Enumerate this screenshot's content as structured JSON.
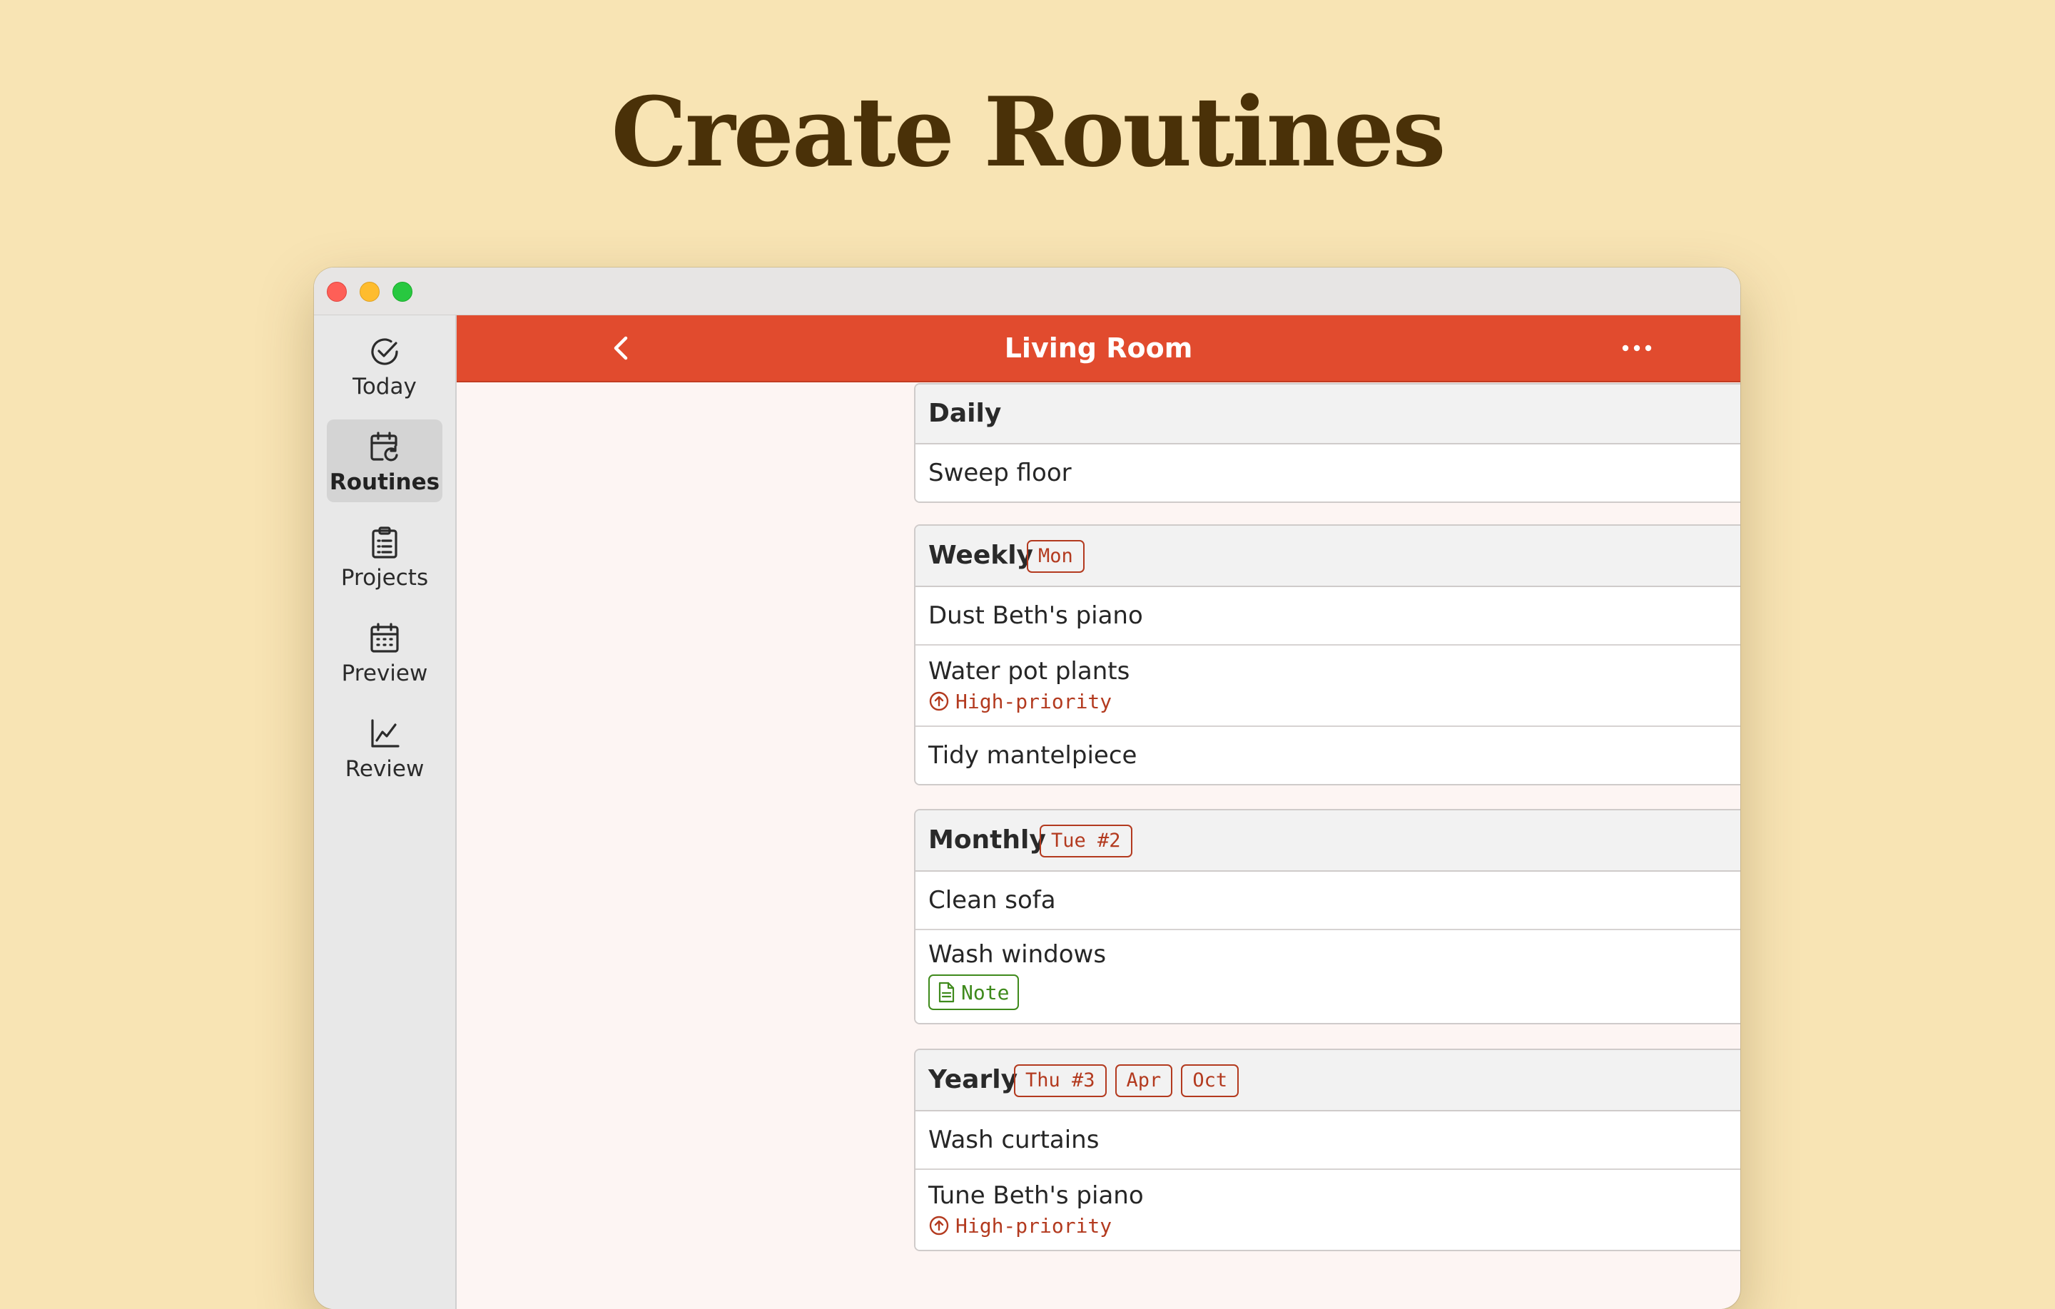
{
  "hero": {
    "title": "Create Routines"
  },
  "sidebar": {
    "items": [
      {
        "label": "Today",
        "icon": "check-circle-icon"
      },
      {
        "label": "Routines",
        "icon": "calendar-repeat-icon",
        "active": true
      },
      {
        "label": "Projects",
        "icon": "clipboard-list-icon"
      },
      {
        "label": "Preview",
        "icon": "calendar-grid-icon"
      },
      {
        "label": "Review",
        "icon": "line-chart-icon"
      }
    ]
  },
  "header": {
    "title": "Living Room",
    "back_icon": "chevron-left-icon",
    "more_icon": "ellipsis-icon"
  },
  "colors": {
    "background": "#f8e4b4",
    "title": "#4a3108",
    "header": "#e14b2e",
    "tag": "#b33a1f",
    "note": "#3f8a1c",
    "more_dots": "#4a8a1e"
  },
  "groups": [
    {
      "title": "Daily",
      "tags": [],
      "tasks": [
        {
          "label": "Sweep floor"
        }
      ]
    },
    {
      "title": "Weekly",
      "tags": [
        "Mon"
      ],
      "tasks": [
        {
          "label": "Dust Beth's piano"
        },
        {
          "label": "Water pot plants",
          "priority": "High-priority"
        },
        {
          "label": "Tidy mantelpiece"
        }
      ]
    },
    {
      "title": "Monthly",
      "tags": [
        "Tue #2"
      ],
      "tasks": [
        {
          "label": "Clean sofa"
        },
        {
          "label": "Wash windows",
          "note": "Note"
        }
      ]
    },
    {
      "title": "Yearly",
      "tags": [
        "Thu #3",
        "Apr",
        "Oct"
      ],
      "tasks": [
        {
          "label": "Wash curtains"
        },
        {
          "label": "Tune Beth's piano",
          "priority": "High-priority"
        }
      ]
    }
  ]
}
